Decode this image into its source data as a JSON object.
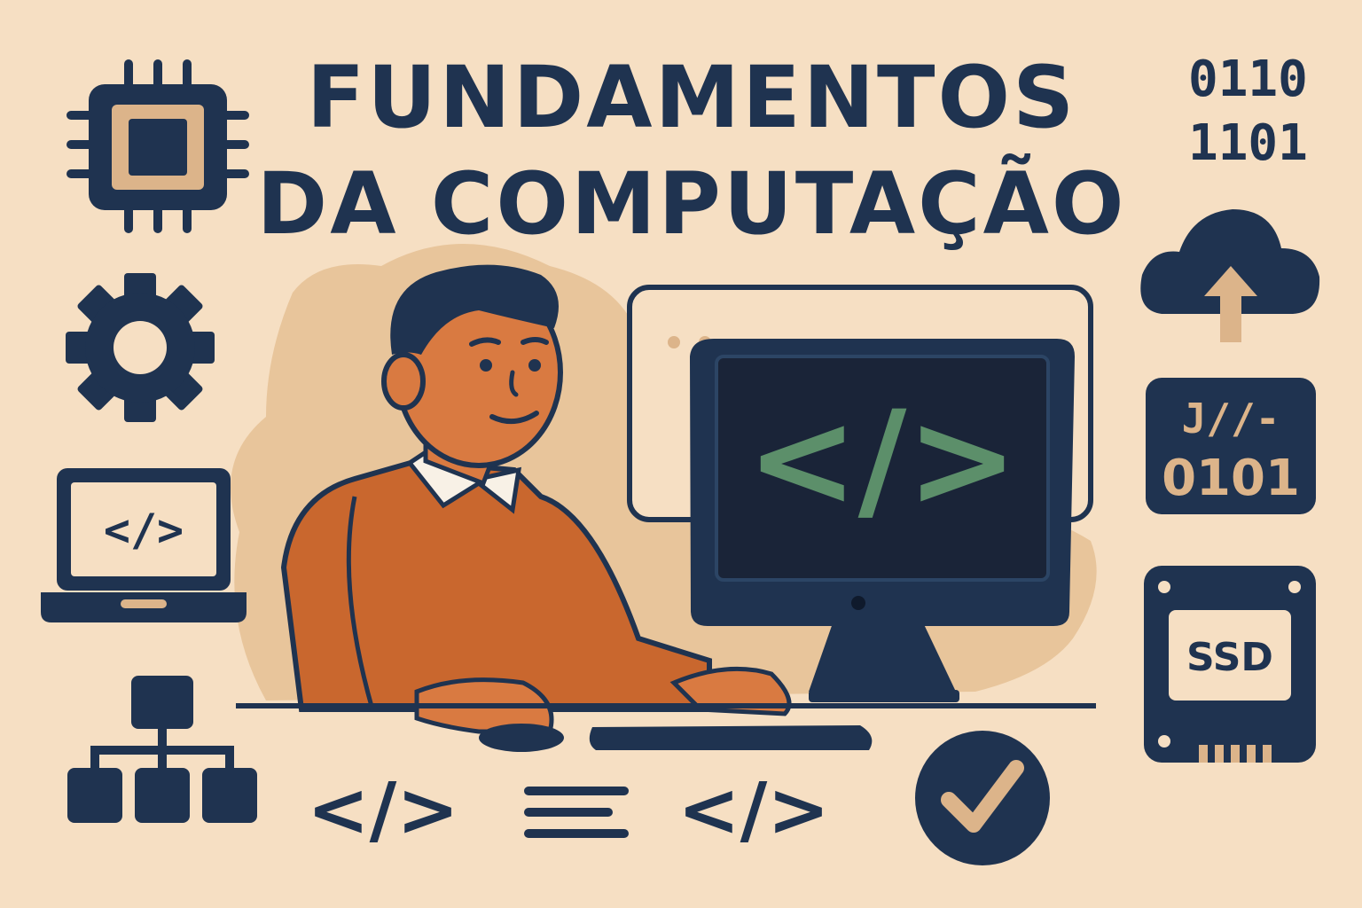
{
  "title": {
    "line1": "FUNDAMENTOS",
    "line2": "DA COMPUTAÇÃO"
  },
  "binary": {
    "top_line1": "0110",
    "top_line2": "1101",
    "panel_bits": "0101",
    "panel_glyphs": "J//-"
  },
  "code_symbols": {
    "laptop": "</>",
    "monitor": "</>",
    "bottom_left": "</>",
    "bottom_right": "</>"
  },
  "ssd": {
    "label": "SSD"
  },
  "icons": [
    "cpu-chip-icon",
    "gear-icon",
    "laptop-icon",
    "network-hierarchy-icon",
    "cloud-upload-icon",
    "binary-panel-icon",
    "ssd-icon",
    "code-icon",
    "text-lines-icon",
    "checkmark-icon"
  ],
  "colors": {
    "background": "#f6dfc3",
    "navy": "#1f3350",
    "orange": "#c9672e",
    "tan": "#dcb48a",
    "code_green": "#5c8f6a"
  }
}
